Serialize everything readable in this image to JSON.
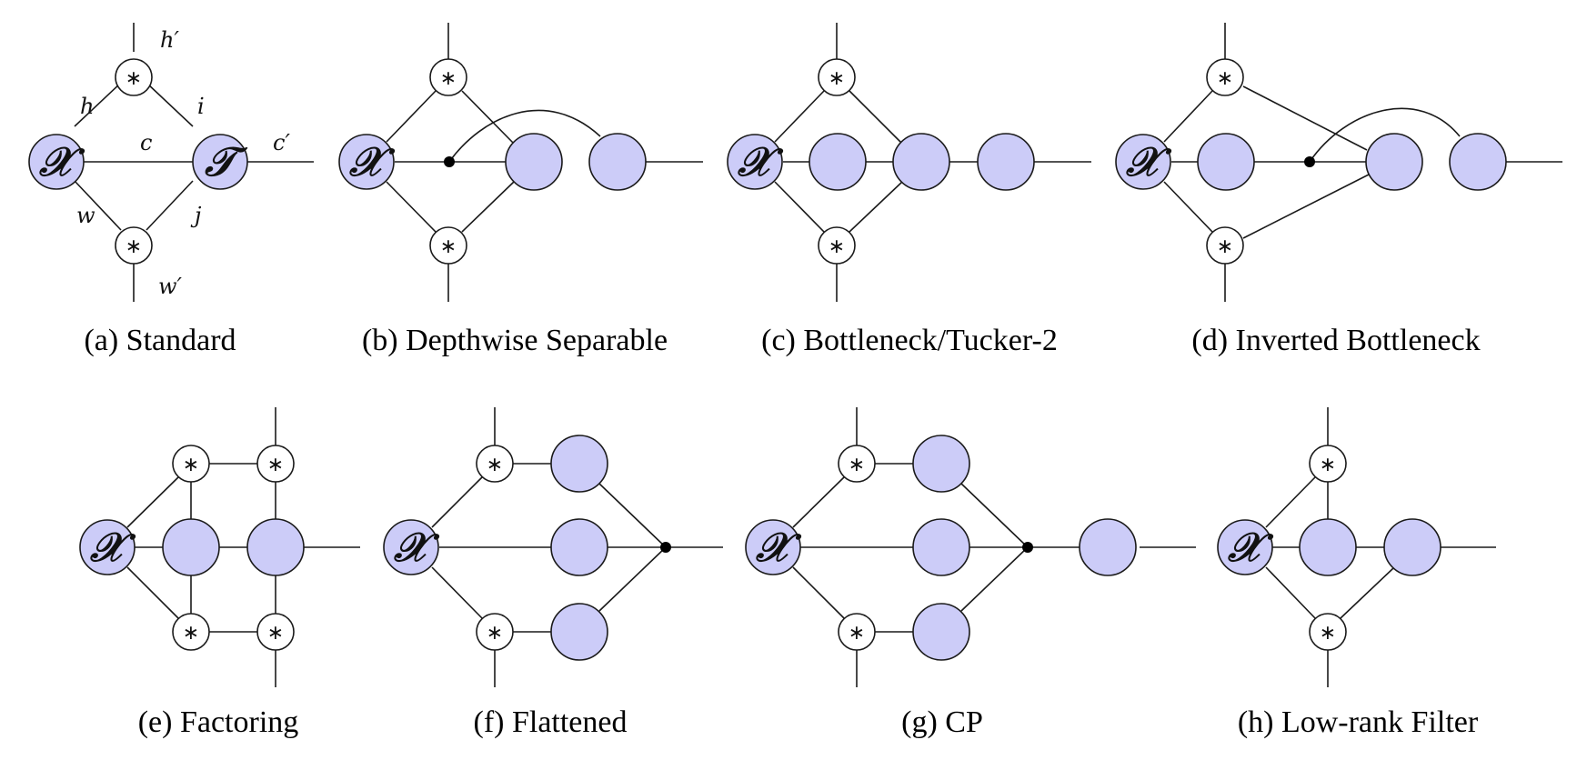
{
  "figure": {
    "colors": {
      "tensor_fill": "#ccccf8",
      "conv_fill": "#ffffff",
      "edge": "#1a1a1a",
      "junction": "#000000"
    },
    "symbols": {
      "input_tensor": "𝒳",
      "kernel_tensor": "𝒯",
      "convolution": "∗"
    },
    "panels": [
      {
        "id": "a",
        "caption": "(a) Standard",
        "index_labels": {
          "h_out": "h′",
          "h": "h",
          "i": "i",
          "c": "c",
          "c_out": "c′",
          "w": "w",
          "j": "j",
          "w_out": "w′"
        }
      },
      {
        "id": "b",
        "caption": "(b) Depthwise Separable"
      },
      {
        "id": "c",
        "caption": "(c) Bottleneck/Tucker-2"
      },
      {
        "id": "d",
        "caption": "(d) Inverted Bottleneck"
      },
      {
        "id": "e",
        "caption": "(e) Factoring"
      },
      {
        "id": "f",
        "caption": "(f) Flattened"
      },
      {
        "id": "g",
        "caption": "(g) CP"
      },
      {
        "id": "h",
        "caption": "(h) Low-rank Filter"
      }
    ]
  }
}
